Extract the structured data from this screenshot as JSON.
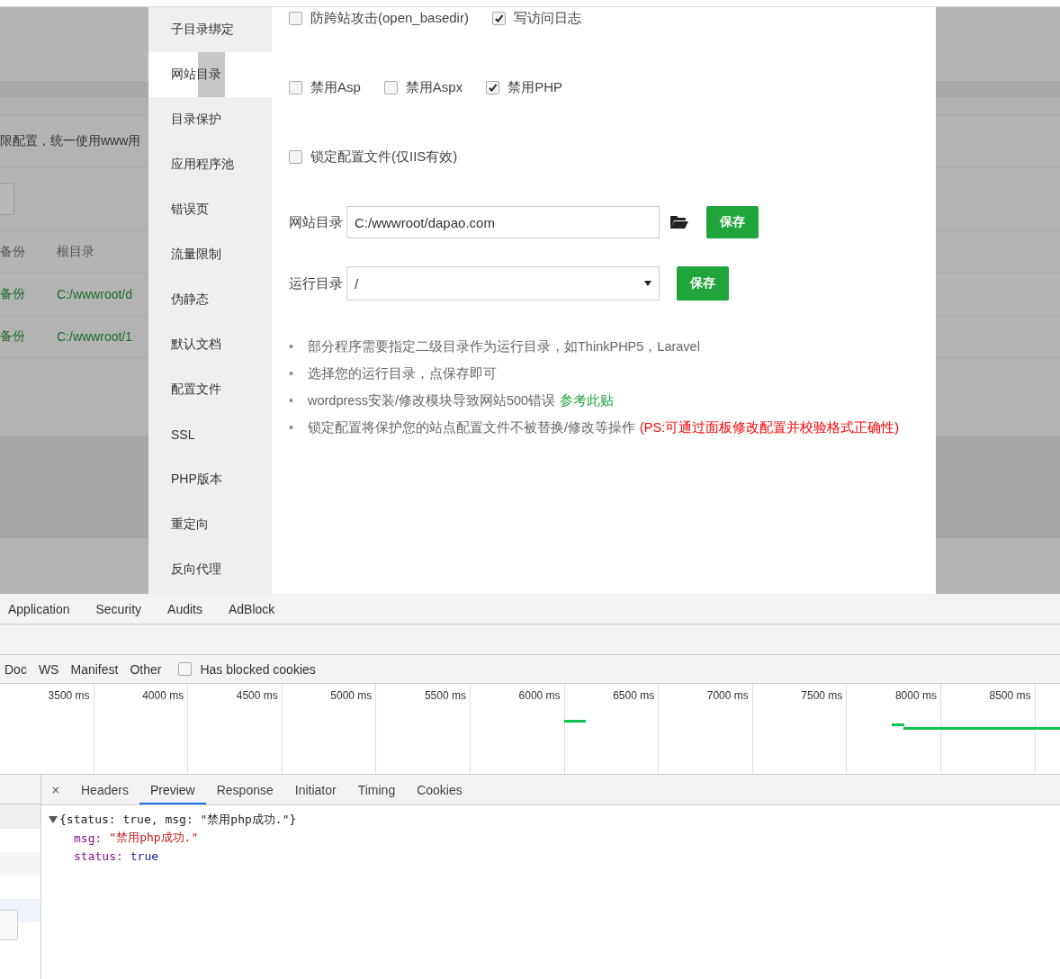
{
  "background_page": {
    "notice": "限配置，统一使用www用",
    "table": {
      "columns": [
        "备份",
        "根目录"
      ],
      "rows": [
        [
          "备份",
          "C:/wwwroot/d"
        ],
        [
          "备份",
          "C:/wwwroot/1"
        ]
      ]
    }
  },
  "modal": {
    "sidebar": {
      "items": [
        {
          "label": "子目录绑定",
          "selected": false
        },
        {
          "label": "网站目录",
          "selected": true
        },
        {
          "label": "目录保护",
          "selected": false
        },
        {
          "label": "应用程序池",
          "selected": false
        },
        {
          "label": "错误页",
          "selected": false
        },
        {
          "label": "流量限制",
          "selected": false
        },
        {
          "label": "伪静态",
          "selected": false
        },
        {
          "label": "默认文档",
          "selected": false
        },
        {
          "label": "配置文件",
          "selected": false
        },
        {
          "label": "SSL",
          "selected": false
        },
        {
          "label": "PHP版本",
          "selected": false
        },
        {
          "label": "重定向",
          "selected": false
        },
        {
          "label": "反向代理",
          "selected": false
        }
      ]
    },
    "top_options": [
      {
        "label": "防跨站攻击(open_basedir)",
        "checked": false
      },
      {
        "label": "写访问日志",
        "checked": true
      }
    ],
    "disable_options": [
      {
        "label": "禁用Asp",
        "checked": false
      },
      {
        "label": "禁用Aspx",
        "checked": false
      },
      {
        "label": "禁用PHP",
        "checked": true
      }
    ],
    "lock_option": {
      "label": "锁定配置文件(仅IIS有效)",
      "checked": false
    },
    "site_dir": {
      "label": "网站目录",
      "value": "C:/wwwroot/dapao.com",
      "button": "保存"
    },
    "run_dir": {
      "label": "运行目录",
      "value": "/",
      "button": "保存"
    },
    "tips": [
      {
        "bullet": "•",
        "text": "部分程序需要指定二级目录作为运行目录，如ThinkPHP5，Laravel"
      },
      {
        "bullet": "•",
        "text": "选择您的运行目录，点保存即可"
      },
      {
        "bullet": "•",
        "text": "wordpress安装/修改模块导致网站500错误",
        "link": "参考此贴"
      },
      {
        "bullet": "•",
        "text": "锁定配置将保护您的站点配置文件不被替换/修改等操作",
        "note": "(PS:可通过面板修改配置并校验格式正确性)"
      }
    ]
  },
  "devtools": {
    "panel_tabs": [
      "Application",
      "Security",
      "Audits",
      "AdBlock"
    ],
    "filters": [
      "Doc",
      "WS",
      "Manifest",
      "Other"
    ],
    "blocked_cookies": {
      "label": "Has blocked cookies",
      "checked": false
    },
    "timeline": {
      "ticks": [
        "3500 ms",
        "4000 ms",
        "4500 ms",
        "5000 ms",
        "5500 ms",
        "6000 ms",
        "6500 ms",
        "7000 ms",
        "7500 ms",
        "8000 ms",
        "8500 ms"
      ]
    },
    "close": "×",
    "detail_tabs": [
      {
        "label": "Headers",
        "selected": false
      },
      {
        "label": "Preview",
        "selected": true
      },
      {
        "label": "Response",
        "selected": false
      },
      {
        "label": "Initiator",
        "selected": false
      },
      {
        "label": "Timing",
        "selected": false
      },
      {
        "label": "Cookies",
        "selected": false
      }
    ],
    "preview": {
      "summary": "{status: true, msg: \"禁用php成功.\"}",
      "expanded": true,
      "fields": [
        {
          "key": "msg:",
          "value": "\"禁用php成功.\"",
          "kind": "string"
        },
        {
          "key": "status:",
          "value": "true",
          "kind": "boolean"
        }
      ]
    }
  }
}
